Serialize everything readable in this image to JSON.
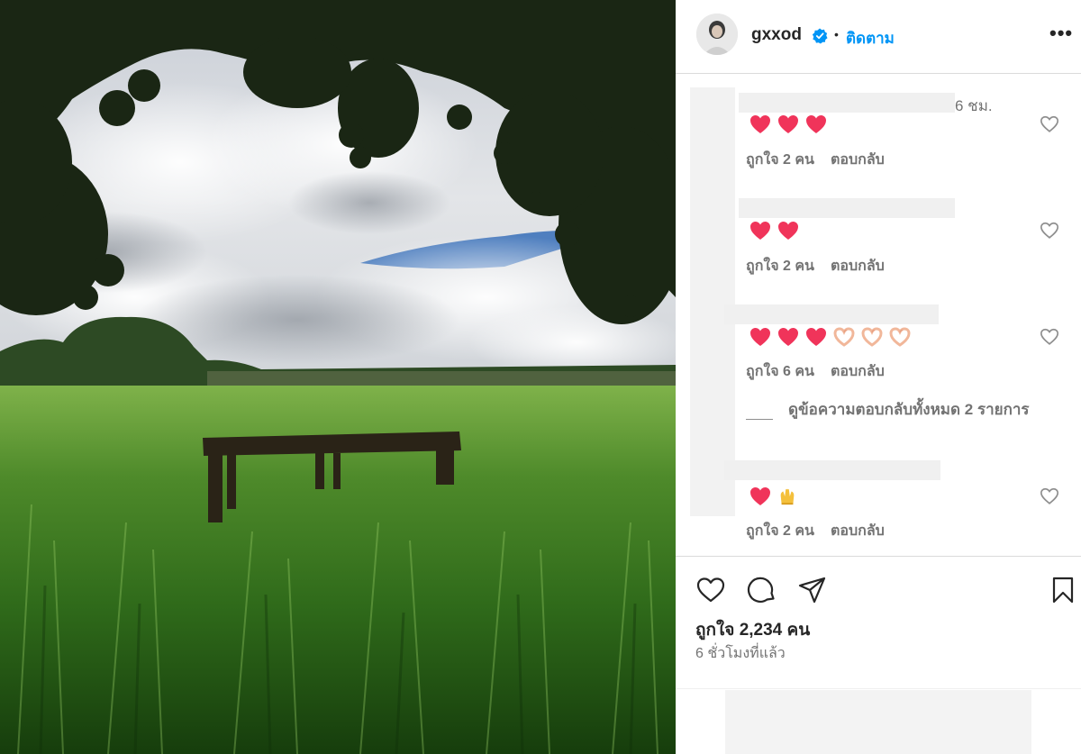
{
  "post": {
    "username": "gxxod",
    "dot": "•",
    "follow_label": "ติดตาม",
    "more_label": "•••",
    "likes_label": "ถูกใจ 2,234 คน",
    "time_ago": "6 ชั่วโมงที่แล้ว"
  },
  "comments": [
    {
      "time": "6 ชม.",
      "emojis": [
        "heart",
        "heart",
        "heart"
      ],
      "likes": "ถูกใจ 2 คน",
      "reply": "ตอบกลับ"
    },
    {
      "time": "",
      "emojis": [
        "heart",
        "heart"
      ],
      "likes": "ถูกใจ 2 คน",
      "reply": "ตอบกลับ"
    },
    {
      "time": "",
      "emojis": [
        "heart",
        "heart",
        "heart",
        "heart-hands",
        "heart-hands",
        "heart-hands"
      ],
      "likes": "ถูกใจ 6 คน",
      "reply": "ตอบกลับ"
    },
    {
      "time": "",
      "emojis": [
        "heart",
        "raised-hands"
      ],
      "likes": "ถูกใจ 2 คน",
      "reply": "ตอบกลับ"
    }
  ],
  "view_replies_label": "ดูข้อความตอบกลับทั้งหมด 2 รายการ",
  "icons": {
    "like": "heart-outline-icon",
    "comment": "comment-icon",
    "share": "paper-plane-icon",
    "save": "bookmark-icon",
    "verified": "verified-badge-icon"
  },
  "colors": {
    "link_blue": "#0095f6",
    "heart_red": "#f0345a",
    "text_primary": "#262626",
    "text_secondary": "#737373"
  }
}
